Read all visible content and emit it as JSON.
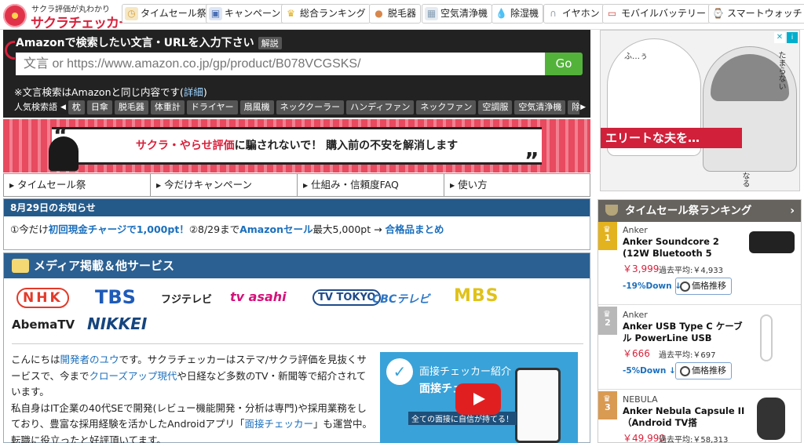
{
  "logo": {
    "tagline": "サクラ評価が丸わかり",
    "name": "サクラチェッカー"
  },
  "nav": [
    {
      "label": "タイムセール祭",
      "icon": "clock-icon",
      "color": "#d9a441"
    },
    {
      "label": "キャンペーン",
      "icon": "gift-icon",
      "color": "#4a6fb5"
    },
    {
      "label": "総合ランキング",
      "icon": "crown-icon",
      "color": "#e3b21f"
    },
    {
      "label": "脱毛器",
      "icon": "epilator-icon",
      "color": "#d8874c"
    },
    {
      "label": "空気清浄機",
      "icon": "air-purifier-icon",
      "color": "#8aa1b5"
    },
    {
      "label": "除湿機",
      "icon": "droplet-icon",
      "color": "#3a86d6"
    },
    {
      "label": "イヤホン",
      "icon": "earphone-icon",
      "color": "#9aa4ae"
    },
    {
      "label": "モバイルバッテリー",
      "icon": "battery-icon",
      "color": "#d2473c"
    },
    {
      "label": "スマートウォッチ",
      "icon": "watch-icon",
      "color": "#555555"
    }
  ],
  "search": {
    "title": "Amazonで検索したい文言・URLを入力下さい",
    "help": "解説",
    "placeholder": "文言 or https://www.amazon.co.jp/gp/product/B078VCGSKS/",
    "button": "Go",
    "note_prefix": "※文言検索はAmazonと同じ内容です(",
    "note_link": "詳細",
    "note_suffix": ")",
    "popular_label": "人気検索語",
    "keywords": [
      "枕",
      "日傘",
      "脱毛器",
      "体重計",
      "ドライヤー",
      "扇風機",
      "ネッククーラー",
      "ハンディファン",
      "ネックファン",
      "空調服",
      "空気清浄機",
      "除"
    ]
  },
  "banner": {
    "highlight": "サクラ・やらせ評価",
    "text1": "に騙されないで！",
    "text2": "購入前の不安を解消します"
  },
  "tabs": [
    "タイムセール祭",
    "今だけキャンペーン",
    "仕組み・信頼度FAQ",
    "使い方"
  ],
  "news": {
    "header": "8月29日のお知らせ",
    "part1": "①今だけ",
    "link1": "初回現金チャージで1,000pt！",
    "part2": "②8/29まで",
    "link2": "Amazonセール",
    "part3": "最大5,000pt → ",
    "link3": "合格品まとめ"
  },
  "media": {
    "header": "メディア掲載＆他サービス",
    "tv": [
      {
        "label": "NHK",
        "color": "#e23b2a"
      },
      {
        "label": "TBS",
        "color": "#1e5bb8"
      },
      {
        "label": "フジテレビ",
        "color": "#222222"
      },
      {
        "label": "tv asahi",
        "color": "#d4117a"
      },
      {
        "label": "TV TOKYO",
        "color": "#1e4b8a"
      },
      {
        "label": "CBCテレビ",
        "color": "#2b76c9"
      },
      {
        "label": "MBS",
        "color": "#e0c21a"
      },
      {
        "label": "AbemaTV",
        "color": "#222222"
      },
      {
        "label": "NIKKEI",
        "color": "#16457e"
      }
    ],
    "intro": {
      "t1": "こんにちは",
      "l1": "開発者のユウ",
      "t2": "です。サクラチェッカーはステマ/サクラ評価を見抜くサービスで、今まで",
      "l2": "クローズアップ現代",
      "t3": "や日経など多数のTV・新聞等で紹介されています。",
      "t4": "私自身はIT企業の40代SEで開発(レビュー機能開発・分析は専門)や採用業務をしており、豊富な採用経験を活かしたAndroidアプリ「",
      "l3": "面接チェッカー",
      "t5": "」も運営中。転職に役立ったと好評頂いてます。"
    },
    "video": {
      "title": "面接チェッカー紹介",
      "title2": "面接チェ",
      "sub": "全ての面接に自信が持てる！"
    }
  },
  "ad": {
    "caption": "エリートな夫を…",
    "texts": [
      "ふ…ぅ",
      "たまらない",
      "なる"
    ]
  },
  "ranking": {
    "header": "タイムセール祭ランキング",
    "items": [
      {
        "rank": "1",
        "brand": "Anker",
        "name": "Anker Soundcore 2 (12W Bluetooth 5",
        "price": "￥3,999",
        "avg": "過去平均:￥4,933",
        "down": "-19%Down ↓",
        "button": "価格推移",
        "color": "#e3b21f"
      },
      {
        "rank": "2",
        "brand": "Anker",
        "name": "Anker USB Type C ケーブル PowerLine USB",
        "price": "￥666",
        "avg": "過去平均:￥697",
        "down": "-5%Down ↓",
        "button": "価格推移",
        "color": "#b8b8b8"
      },
      {
        "rank": "3",
        "brand": "NEBULA",
        "name": "Anker Nebula Capsule II（Android TV搭",
        "price": "￥49,990",
        "avg": "過去平均:￥58,313",
        "down": "",
        "button": "",
        "color": "#d99a52"
      }
    ]
  }
}
